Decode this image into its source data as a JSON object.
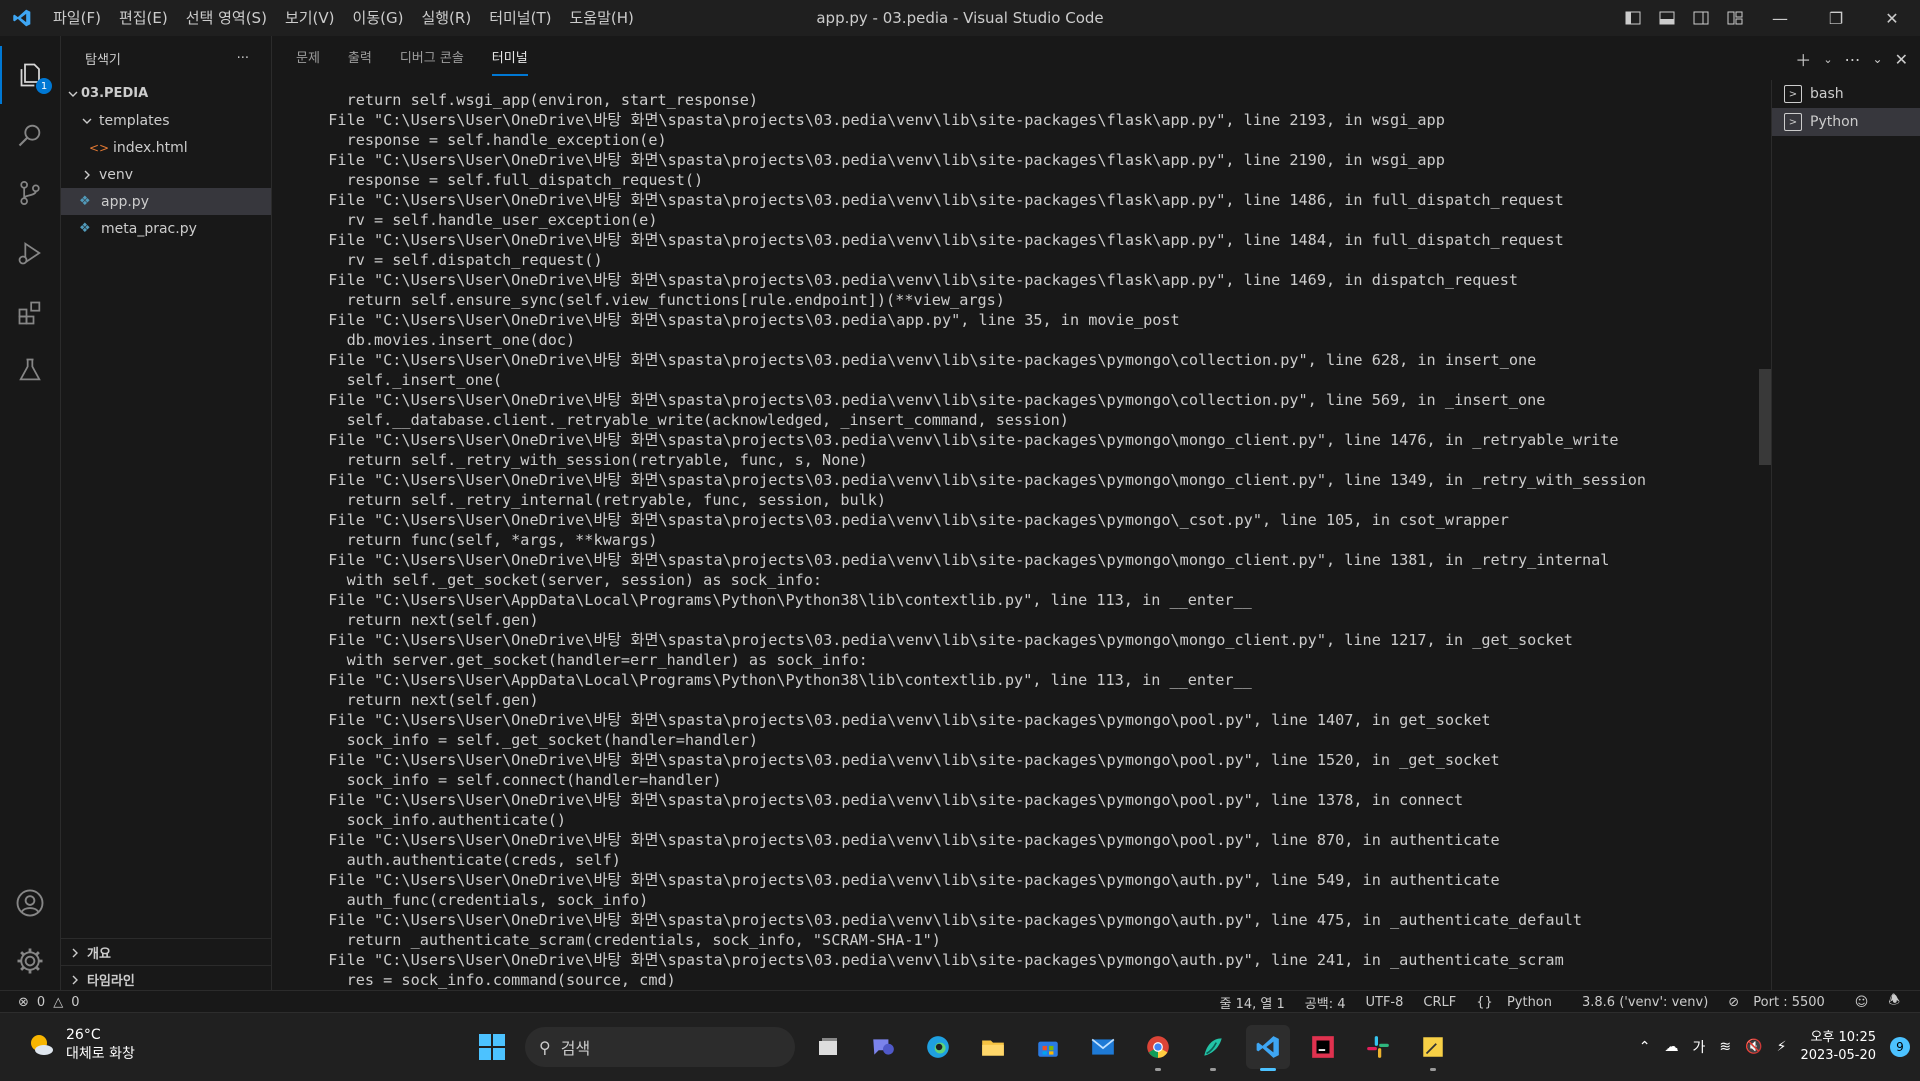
{
  "window": {
    "title": "app.py - 03.pedia - Visual Studio Code",
    "menu": [
      "파일(F)",
      "편집(E)",
      "선택 영역(S)",
      "보기(V)",
      "이동(G)",
      "실행(R)",
      "터미널(T)",
      "도움말(H)"
    ]
  },
  "activity": {
    "explorer_badge": "1"
  },
  "sidebar": {
    "title": "탐색기",
    "more": "···",
    "root": "03.PEDIA",
    "items": [
      {
        "label": "templates"
      },
      {
        "label": "index.html"
      },
      {
        "label": "venv"
      },
      {
        "label": "app.py"
      },
      {
        "label": "meta_prac.py"
      }
    ],
    "outline": "개요",
    "timeline": "타임라인"
  },
  "panel": {
    "tabs": [
      "문제",
      "출력",
      "디버그 콘솔",
      "터미널"
    ],
    "active_tab": "터미널",
    "terminal_lines": [
      "    return self.wsgi_app(environ, start_response)",
      "  File \"C:\\Users\\User\\OneDrive\\바탕 화면\\spasta\\projects\\03.pedia\\venv\\lib\\site-packages\\flask\\app.py\", line 2193, in wsgi_app",
      "    response = self.handle_exception(e)",
      "  File \"C:\\Users\\User\\OneDrive\\바탕 화면\\spasta\\projects\\03.pedia\\venv\\lib\\site-packages\\flask\\app.py\", line 2190, in wsgi_app",
      "    response = self.full_dispatch_request()",
      "  File \"C:\\Users\\User\\OneDrive\\바탕 화면\\spasta\\projects\\03.pedia\\venv\\lib\\site-packages\\flask\\app.py\", line 1486, in full_dispatch_request",
      "    rv = self.handle_user_exception(e)",
      "  File \"C:\\Users\\User\\OneDrive\\바탕 화면\\spasta\\projects\\03.pedia\\venv\\lib\\site-packages\\flask\\app.py\", line 1484, in full_dispatch_request",
      "    rv = self.dispatch_request()",
      "  File \"C:\\Users\\User\\OneDrive\\바탕 화면\\spasta\\projects\\03.pedia\\venv\\lib\\site-packages\\flask\\app.py\", line 1469, in dispatch_request",
      "    return self.ensure_sync(self.view_functions[rule.endpoint])(**view_args)",
      "  File \"C:\\Users\\User\\OneDrive\\바탕 화면\\spasta\\projects\\03.pedia\\app.py\", line 35, in movie_post",
      "    db.movies.insert_one(doc)",
      "  File \"C:\\Users\\User\\OneDrive\\바탕 화면\\spasta\\projects\\03.pedia\\venv\\lib\\site-packages\\pymongo\\collection.py\", line 628, in insert_one",
      "    self._insert_one(",
      "  File \"C:\\Users\\User\\OneDrive\\바탕 화면\\spasta\\projects\\03.pedia\\venv\\lib\\site-packages\\pymongo\\collection.py\", line 569, in _insert_one",
      "    self.__database.client._retryable_write(acknowledged, _insert_command, session)",
      "  File \"C:\\Users\\User\\OneDrive\\바탕 화면\\spasta\\projects\\03.pedia\\venv\\lib\\site-packages\\pymongo\\mongo_client.py\", line 1476, in _retryable_write",
      "    return self._retry_with_session(retryable, func, s, None)",
      "  File \"C:\\Users\\User\\OneDrive\\바탕 화면\\spasta\\projects\\03.pedia\\venv\\lib\\site-packages\\pymongo\\mongo_client.py\", line 1349, in _retry_with_session",
      "    return self._retry_internal(retryable, func, session, bulk)",
      "  File \"C:\\Users\\User\\OneDrive\\바탕 화면\\spasta\\projects\\03.pedia\\venv\\lib\\site-packages\\pymongo\\_csot.py\", line 105, in csot_wrapper",
      "    return func(self, *args, **kwargs)",
      "  File \"C:\\Users\\User\\OneDrive\\바탕 화면\\spasta\\projects\\03.pedia\\venv\\lib\\site-packages\\pymongo\\mongo_client.py\", line 1381, in _retry_internal",
      "    with self._get_socket(server, session) as sock_info:",
      "  File \"C:\\Users\\User\\AppData\\Local\\Programs\\Python\\Python38\\lib\\contextlib.py\", line 113, in __enter__",
      "    return next(self.gen)",
      "  File \"C:\\Users\\User\\OneDrive\\바탕 화면\\spasta\\projects\\03.pedia\\venv\\lib\\site-packages\\pymongo\\mongo_client.py\", line 1217, in _get_socket",
      "    with server.get_socket(handler=err_handler) as sock_info:",
      "  File \"C:\\Users\\User\\AppData\\Local\\Programs\\Python\\Python38\\lib\\contextlib.py\", line 113, in __enter__",
      "    return next(self.gen)",
      "  File \"C:\\Users\\User\\OneDrive\\바탕 화면\\spasta\\projects\\03.pedia\\venv\\lib\\site-packages\\pymongo\\pool.py\", line 1407, in get_socket",
      "    sock_info = self._get_socket(handler=handler)",
      "  File \"C:\\Users\\User\\OneDrive\\바탕 화면\\spasta\\projects\\03.pedia\\venv\\lib\\site-packages\\pymongo\\pool.py\", line 1520, in _get_socket",
      "    sock_info = self.connect(handler=handler)",
      "  File \"C:\\Users\\User\\OneDrive\\바탕 화면\\spasta\\projects\\03.pedia\\venv\\lib\\site-packages\\pymongo\\pool.py\", line 1378, in connect",
      "    sock_info.authenticate()",
      "  File \"C:\\Users\\User\\OneDrive\\바탕 화면\\spasta\\projects\\03.pedia\\venv\\lib\\site-packages\\pymongo\\pool.py\", line 870, in authenticate",
      "    auth.authenticate(creds, self)",
      "  File \"C:\\Users\\User\\OneDrive\\바탕 화면\\spasta\\projects\\03.pedia\\venv\\lib\\site-packages\\pymongo\\auth.py\", line 549, in authenticate",
      "    auth_func(credentials, sock_info)",
      "  File \"C:\\Users\\User\\OneDrive\\바탕 화면\\spasta\\projects\\03.pedia\\venv\\lib\\site-packages\\pymongo\\auth.py\", line 475, in _authenticate_default",
      "    return _authenticate_scram(credentials, sock_info, \"SCRAM-SHA-1\")",
      "  File \"C:\\Users\\User\\OneDrive\\바탕 화면\\spasta\\projects\\03.pedia\\venv\\lib\\site-packages\\pymongo\\auth.py\", line 241, in _authenticate_scram",
      "    res = sock_info.command(source, cmd)"
    ],
    "terminals": [
      "bash",
      "Python"
    ],
    "active_terminal": "Python"
  },
  "statusbar": {
    "errors": "0",
    "warnings": "0",
    "position": "줄 14, 열 1",
    "spaces": "공백: 4",
    "encoding": "UTF-8",
    "eol": "CRLF",
    "language": "Python",
    "interpreter": "3.8.6 ('venv': venv)",
    "port": "Port : 5500"
  },
  "taskbar": {
    "weather_temp": "26°C",
    "weather_desc": "대체로 화창",
    "search_placeholder": "검색",
    "ime": "가",
    "time": "오후 10:25",
    "date": "2023-05-20",
    "notifications": "9"
  },
  "colors": {
    "accent": "#0078d4",
    "editor_bg": "#1e1e1e",
    "sidebar_bg": "#181818"
  },
  "icons": [
    "vscode-logo-icon",
    "explorer-icon",
    "search-icon",
    "source-control-icon",
    "run-debug-icon",
    "extensions-icon",
    "testing-icon",
    "account-icon",
    "settings-gear-icon"
  ]
}
